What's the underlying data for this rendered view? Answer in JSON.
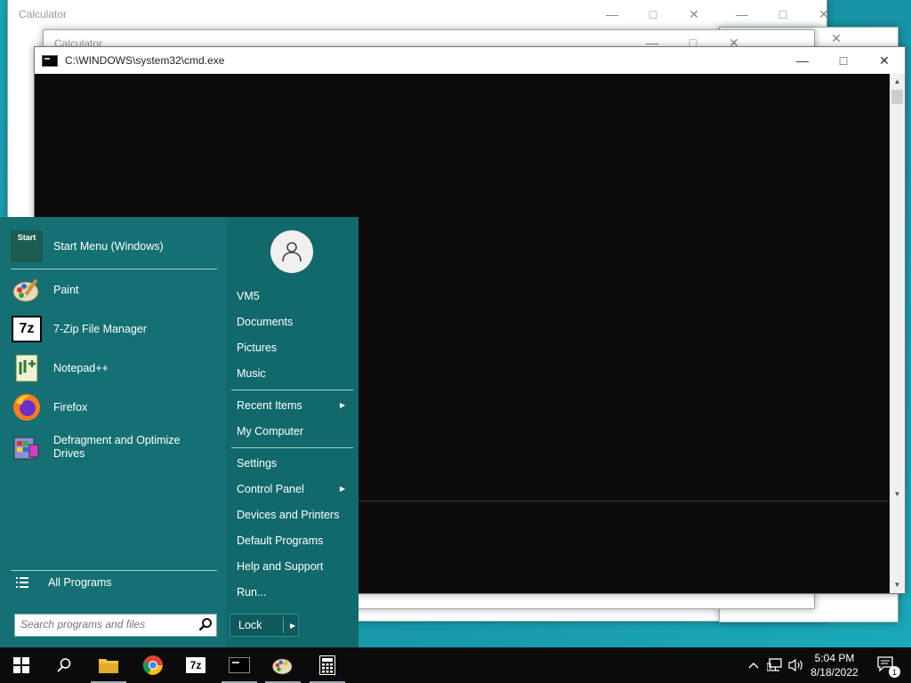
{
  "windows": {
    "calc_back_title": "Calculator",
    "calc_front_title": "Calculator",
    "cmd_title": "C:\\WINDOWS\\system32\\cmd.exe"
  },
  "start_menu": {
    "programs": [
      {
        "label": "Start Menu (Windows)",
        "icon": "start-menu-icon"
      },
      {
        "label": "Paint",
        "icon": "paint-icon"
      },
      {
        "label": "7-Zip File Manager",
        "icon": "7zip-icon"
      },
      {
        "label": "Notepad++",
        "icon": "notepadpp-icon"
      },
      {
        "label": "Firefox",
        "icon": "firefox-icon"
      },
      {
        "label": "Defragment and Optimize Drives",
        "icon": "defrag-icon"
      }
    ],
    "start_icon_text": "Start",
    "zip_icon_text": "7z",
    "all_programs": "All Programs",
    "search_placeholder": "Search programs and files",
    "right_items": [
      {
        "label": "VM5"
      },
      {
        "label": "Documents"
      },
      {
        "label": "Pictures"
      },
      {
        "label": "Music"
      },
      {
        "label": "Recent Items"
      },
      {
        "label": "My Computer"
      },
      {
        "label": "Settings"
      },
      {
        "label": "Control Panel"
      },
      {
        "label": "Devices and Printers"
      },
      {
        "label": "Default Programs"
      },
      {
        "label": "Help and Support"
      },
      {
        "label": "Run..."
      }
    ],
    "lock_label": "Lock"
  },
  "taskbar": {
    "zip_text": "7z",
    "time": "5:04 PM",
    "date": "8/18/2022",
    "notification_count": "1"
  },
  "colors": {
    "start_bg": "#147073",
    "desktop": "#1aa7b8",
    "console_bg": "#0c0c0c"
  }
}
